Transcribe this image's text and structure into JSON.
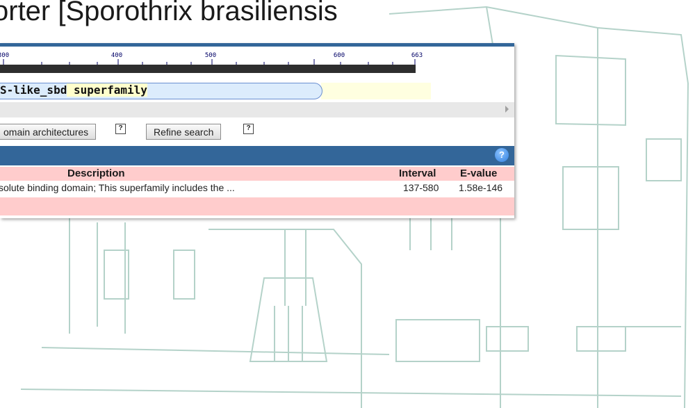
{
  "slide": {
    "title": "orter [Sporothrix brasiliensis"
  },
  "ruler": {
    "ticks": [
      "300",
      "400",
      "500",
      "600",
      "663"
    ]
  },
  "hit": {
    "name_part1": "S-like_sbd",
    "name_part2": " superfamily"
  },
  "buttons": {
    "domain_architectures": "omain architectures",
    "refine_search": "Refine search",
    "help": "?"
  },
  "table": {
    "headers": {
      "description": "Description",
      "interval": "Interval",
      "evalue": "E-value"
    },
    "rows": [
      {
        "description": "solute binding domain; This superfamily includes the ...",
        "interval": "137-580",
        "evalue": "1.58e-146"
      }
    ]
  },
  "colors": {
    "header_blue": "#336699",
    "table_pink": "#ffcccc",
    "domain_fill": "#dcecfc",
    "sketch_teal": "#6fa89a"
  }
}
